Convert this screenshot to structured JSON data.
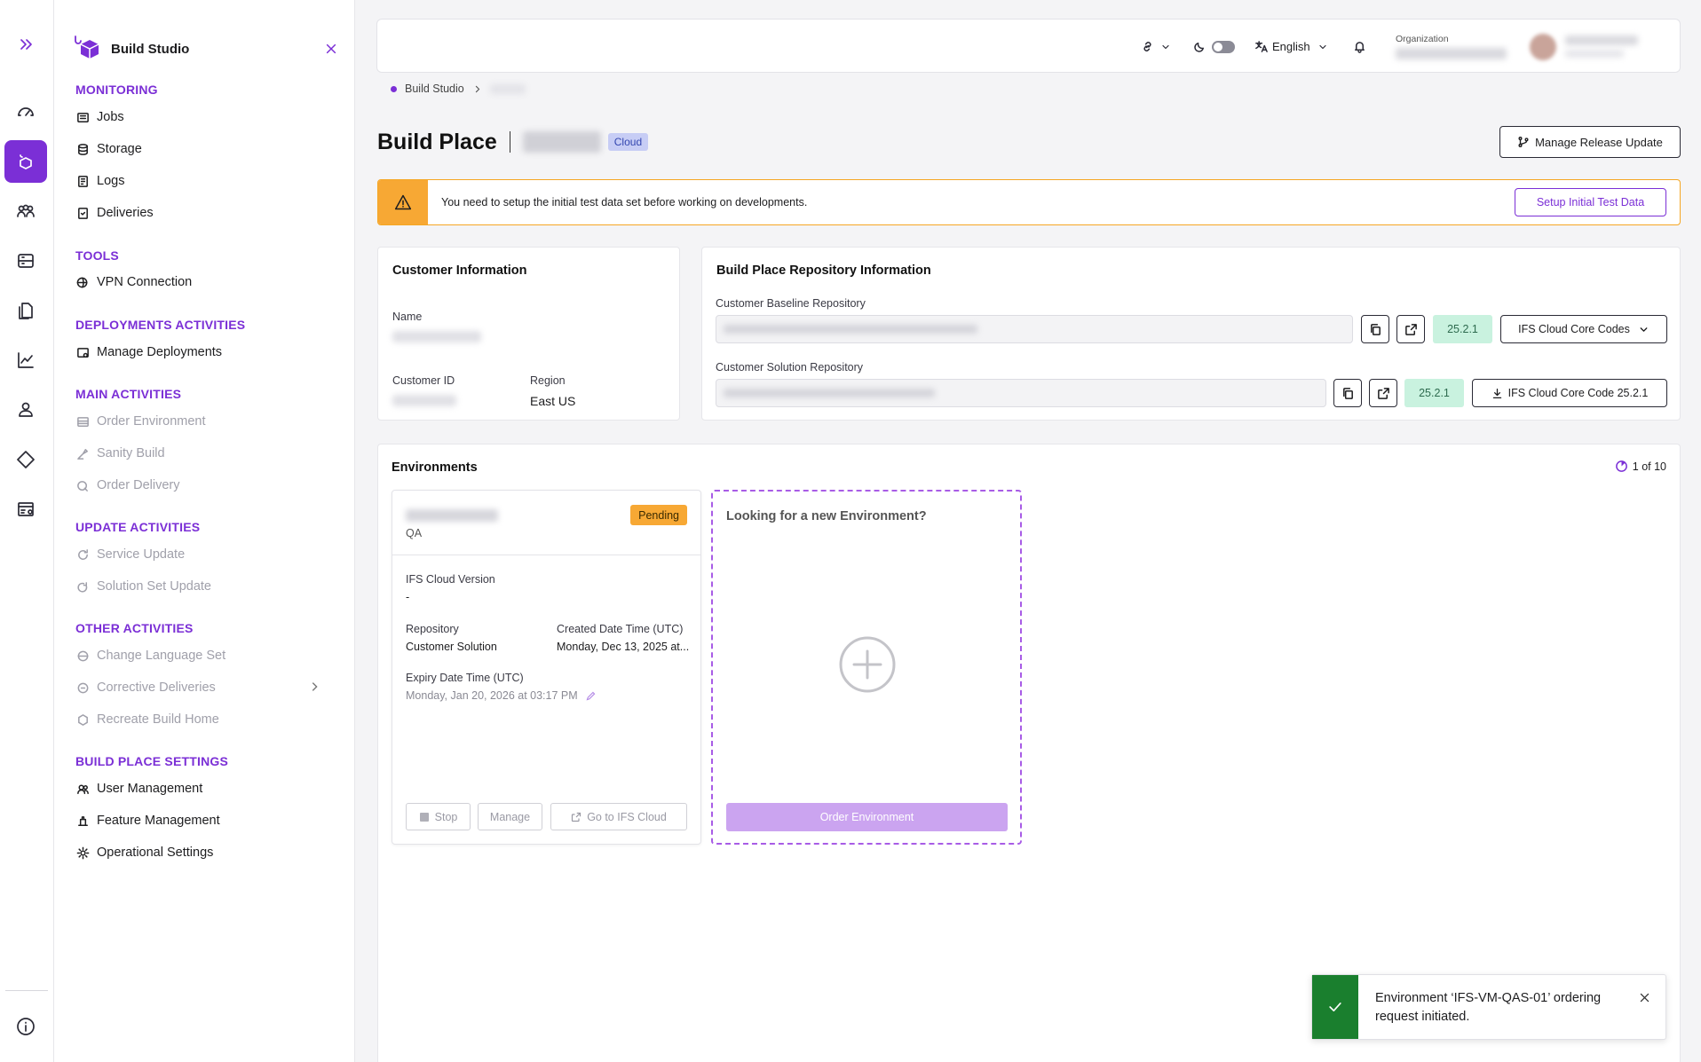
{
  "brand": {
    "accent": "#7b2fd6",
    "warning": "#f7a834",
    "success": "#1a7f2e"
  },
  "nav": {
    "title": "Build Studio",
    "sections": [
      {
        "label": "MONITORING",
        "items": [
          "Jobs",
          "Storage",
          "Logs",
          "Deliveries"
        ]
      },
      {
        "label": "TOOLS",
        "items": [
          "VPN Connection"
        ]
      },
      {
        "label": "DEPLOYMENTS ACTIVITIES",
        "items": [
          "Manage Deployments"
        ]
      },
      {
        "label": "MAIN ACTIVITIES",
        "items": [
          "Order Environment",
          "Sanity Build",
          "Order Delivery"
        ]
      },
      {
        "label": "UPDATE ACTIVITIES",
        "items": [
          "Service Update",
          "Solution Set Update"
        ]
      },
      {
        "label": "OTHER ACTIVITIES",
        "items": [
          "Change Language Set",
          "Corrective Deliveries",
          "Recreate Build Home"
        ]
      },
      {
        "label": "BUILD PLACE SETTINGS",
        "items": [
          "User Management",
          "Feature Management",
          "Operational Settings"
        ]
      }
    ]
  },
  "topbar": {
    "language": "English",
    "org_label": "Organization"
  },
  "breadcrumb": {
    "root": "Build Studio"
  },
  "page": {
    "title": "Build Place",
    "badge": "Cloud",
    "release_button": "Manage Release Update"
  },
  "banner": {
    "text": "You need to setup the initial test data set before working on developments.",
    "button": "Setup Initial Test Data"
  },
  "customer": {
    "title": "Customer Information",
    "name_label": "Name",
    "id_label": "Customer ID",
    "region_label": "Region",
    "region": "East US"
  },
  "repo": {
    "title": "Build Place Repository Information",
    "baseline_label": "Customer Baseline Repository",
    "baseline_version": "25.2.1",
    "baseline_button": "IFS Cloud Core Codes",
    "solution_label": "Customer Solution Repository",
    "solution_version": "25.2.1",
    "solution_button": "IFS Cloud Core Code 25.2.1"
  },
  "environments": {
    "title": "Environments",
    "count": "1 of 10",
    "card": {
      "status": "Pending",
      "type": "QA",
      "version_label": "IFS Cloud Version",
      "version": "-",
      "repo_label": "Repository",
      "repo": "Customer Solution",
      "created_label": "Created Date Time (UTC)",
      "created": "Monday, Dec 13, 2025 at...",
      "expiry_label": "Expiry Date Time (UTC)",
      "expiry": "Monday, Jan 20, 2026 at 03:17 PM",
      "stop": "Stop",
      "manage": "Manage",
      "go": "Go to IFS Cloud"
    },
    "new": {
      "title": "Looking for a new Environment?",
      "button": "Order Environment"
    }
  },
  "toast": {
    "message": "Environment ‘IFS-VM-QAS-01’ ordering request initiated."
  }
}
